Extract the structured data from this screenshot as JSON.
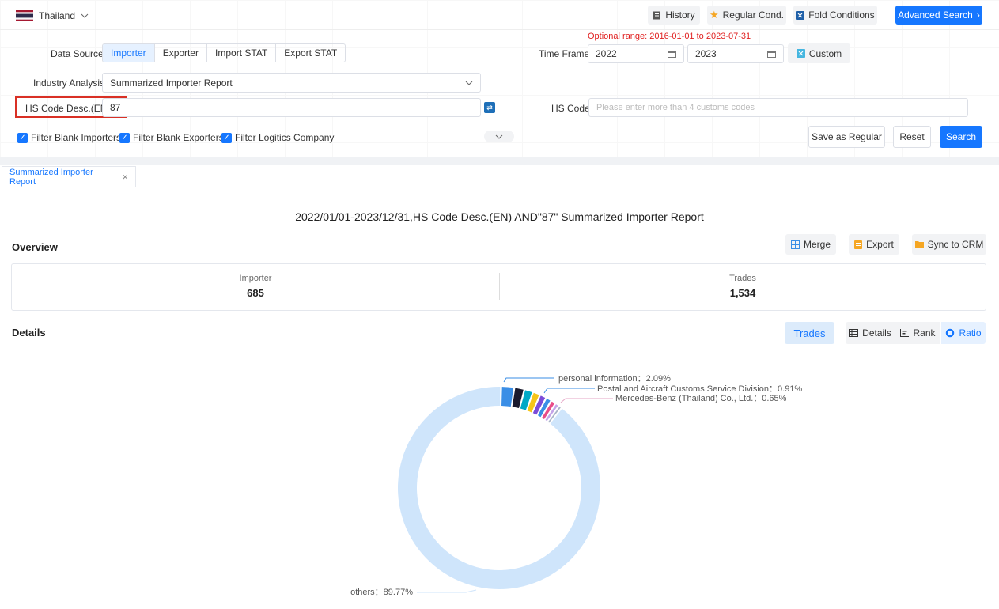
{
  "topbar": {
    "country": "Thailand",
    "history": "History",
    "regular_cond": "Regular Cond.",
    "fold_conditions": "Fold Conditions",
    "advanced_search": "Advanced Search"
  },
  "filters": {
    "optional_range_label": "Optional range:",
    "optional_range_value": "2016-01-01 to 2023-07-31",
    "data_source_label": "Data Source",
    "data_source_options": [
      "Importer",
      "Exporter",
      "Import STAT",
      "Export STAT"
    ],
    "data_source_active": "Importer",
    "time_frame_label": "Time Frame",
    "time_from": "2022",
    "time_to": "2023",
    "custom": "Custom",
    "industry_label": "Industry Analysis",
    "industry_value": "Summarized Importer Report",
    "hs_desc_label": "HS Code Desc.(EN)",
    "hs_desc_value": "87",
    "hs_code_label": "HS Code",
    "hs_code_placeholder": "Please enter more than 4 customs codes",
    "cb_blank_importers": "Filter Blank Importers",
    "cb_blank_exporters": "Filter Blank Exporters",
    "cb_logistics": "Filter Logitics Company",
    "save_regular": "Save as Regular",
    "reset": "Reset",
    "search": "Search"
  },
  "tab": {
    "label": "Summarized Importer Report",
    "close": "×"
  },
  "report": {
    "title": "2022/01/01-2023/12/31,HS Code Desc.(EN) AND\"87\" Summarized Importer Report",
    "overview": "Overview",
    "merge": "Merge",
    "export": "Export",
    "sync_crm": "Sync to CRM",
    "importer_label": "Importer",
    "importer_value": "685",
    "trades_label": "Trades",
    "trades_value": "1,534",
    "details": "Details",
    "trades_btn": "Trades",
    "details_btn": "Details",
    "rank_btn": "Rank",
    "ratio_btn": "Ratio"
  },
  "chart_data": {
    "type": "pie",
    "slices": [
      {
        "label": "personal information",
        "value": 2.09,
        "color": "#3a8ee6"
      },
      {
        "label": "",
        "value": 1.6,
        "color": "#1a1a2e"
      },
      {
        "label": "",
        "value": 1.4,
        "color": "#00a8c6"
      },
      {
        "label": "",
        "value": 1.2,
        "color": "#f5c518"
      },
      {
        "label": "",
        "value": 1.05,
        "color": "#7b4bd8"
      },
      {
        "label": "Postal and Aircraft Customs Service Division",
        "value": 0.91,
        "color": "#3a8ee6"
      },
      {
        "label": "",
        "value": 0.8,
        "color": "#e94d8a"
      },
      {
        "label": "Mercedes-Benz (Thailand) Co., Ltd.",
        "value": 0.65,
        "color": "#c4a4e8"
      },
      {
        "label": "",
        "value": 0.53,
        "color": "#a8b4c8"
      },
      {
        "label": "others",
        "value": 89.77,
        "color": "#cfe5fb"
      }
    ],
    "callouts": [
      {
        "text": "personal information：2.09%"
      },
      {
        "text": "Postal and Aircraft Customs Service Division：0.91%"
      },
      {
        "text": "Mercedes-Benz (Thailand) Co., Ltd.：0.65%"
      },
      {
        "text": "others：89.77%"
      }
    ]
  }
}
